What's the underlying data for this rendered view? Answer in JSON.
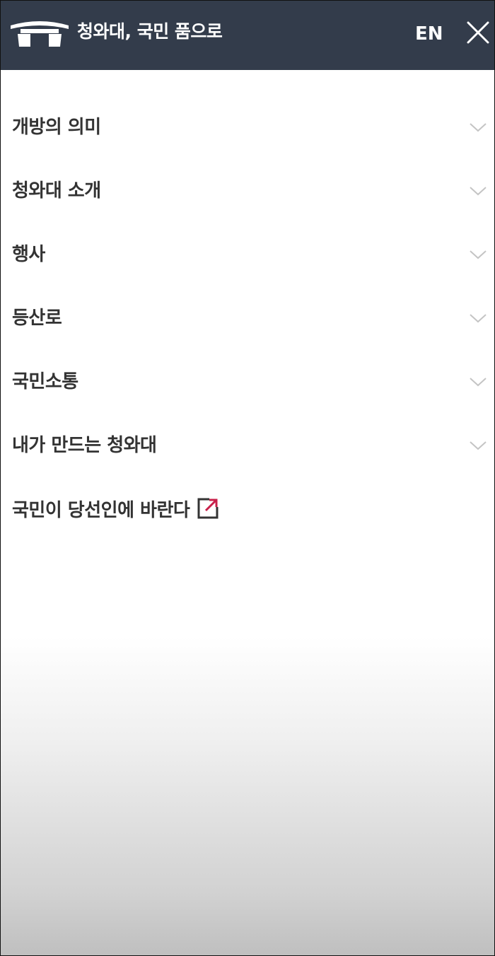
{
  "header": {
    "logo_icon": "gate-logo-icon",
    "title": "청와대, 국민 품으로",
    "lang_label": "EN",
    "close_icon": "close-icon",
    "background_color": "#333c4b"
  },
  "menu": {
    "items": [
      {
        "label": "개방의 의미",
        "icon": "chevron-down-icon"
      },
      {
        "label": "청와대 소개",
        "icon": "chevron-down-icon"
      },
      {
        "label": "행사",
        "icon": "chevron-down-icon"
      },
      {
        "label": "등산로",
        "icon": "chevron-down-icon"
      },
      {
        "label": "국민소통",
        "icon": "chevron-down-icon"
      },
      {
        "label": "내가 만드는 청와대",
        "icon": "chevron-down-icon"
      },
      {
        "label": "국민이 당선인에 바란다",
        "icon": "external-link-icon"
      }
    ],
    "external_link_color": "#c8204a"
  }
}
